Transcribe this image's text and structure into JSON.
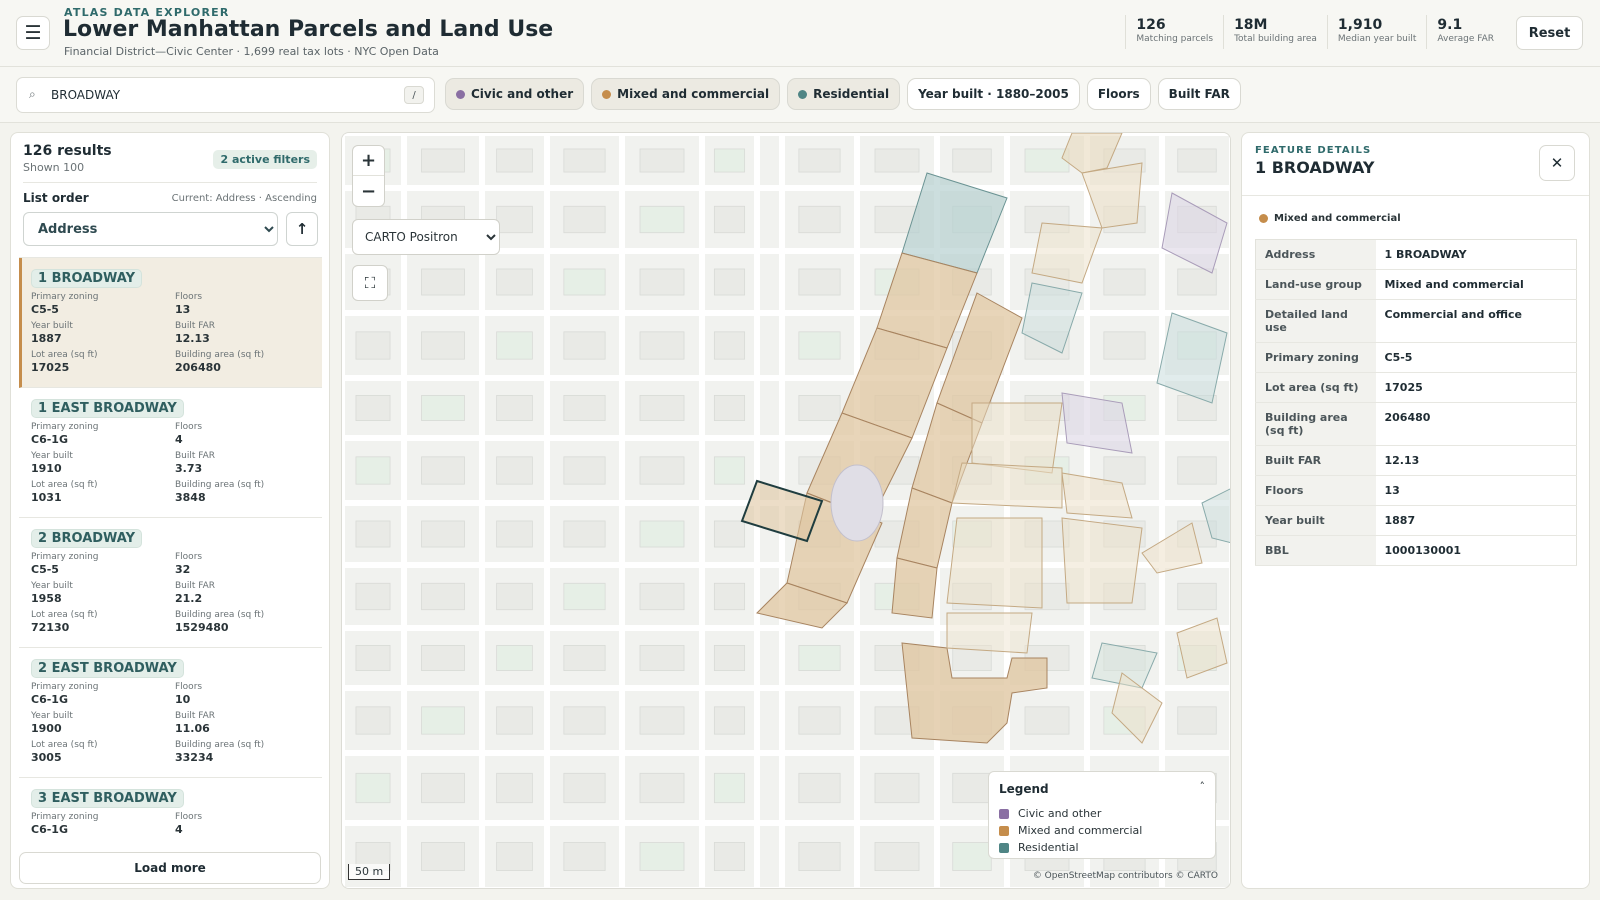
{
  "header": {
    "eyebrow": "ATLAS DATA EXPLORER",
    "title": "Lower Manhattan Parcels and Land Use",
    "subtitle": "Financial District—Civic Center · 1,699 real tax lots · NYC Open Data",
    "stats": [
      {
        "value": "126",
        "label": "Matching parcels"
      },
      {
        "value": "18M",
        "label": "Total building area"
      },
      {
        "value": "1,910",
        "label": "Median year built"
      },
      {
        "value": "9.1",
        "label": "Average FAR"
      }
    ],
    "reset_label": "Reset",
    "menu_icon": "☰"
  },
  "search": {
    "icon": "⌕",
    "value": "BROADWAY",
    "shortcut": "/"
  },
  "chips": [
    {
      "label": "Civic and other",
      "color": "#8a6fa3",
      "active": true
    },
    {
      "label": "Mixed and commercial",
      "color": "#c58d4c",
      "active": true
    },
    {
      "label": "Residential",
      "color": "#4f8585",
      "active": true
    },
    {
      "label": "Year built · 1880–2005"
    },
    {
      "label": "Floors"
    },
    {
      "label": "Built FAR"
    }
  ],
  "results": {
    "count_label": "126 results",
    "shown_label": "Shown 100",
    "filters_badge": "2 active filters",
    "order_label": "List order",
    "order_current": "Current: Address · Ascending",
    "order_value": "Address",
    "order_options": [
      "Address"
    ],
    "direction_icon": "↑",
    "load_more_label": "Load more",
    "field_labels": {
      "zoning": "Primary zoning",
      "floors": "Floors",
      "year": "Year built",
      "far": "Built FAR",
      "lot": "Lot area (sq ft)",
      "bldg": "Building area (sq ft)"
    },
    "items": [
      {
        "title": "1 BROADWAY",
        "zoning": "C5-5",
        "floors": "13",
        "year": "1887",
        "far": "12.13",
        "lot": "17025",
        "bldg": "206480"
      },
      {
        "title": "1 EAST BROADWAY",
        "zoning": "C6-1G",
        "floors": "4",
        "year": "1910",
        "far": "3.73",
        "lot": "1031",
        "bldg": "3848"
      },
      {
        "title": "2 BROADWAY",
        "zoning": "C5-5",
        "floors": "32",
        "year": "1958",
        "far": "21.2",
        "lot": "72130",
        "bldg": "1529480"
      },
      {
        "title": "2 EAST BROADWAY",
        "zoning": "C6-1G",
        "floors": "10",
        "year": "1900",
        "far": "11.06",
        "lot": "3005",
        "bldg": "33234"
      },
      {
        "title": "3 EAST BROADWAY",
        "zoning": "C6-1G",
        "floors": "4"
      }
    ]
  },
  "map": {
    "zoom_in": "+",
    "zoom_out": "−",
    "basemap_value": "CARTO Positron",
    "fullscreen_icon": "⛶",
    "scale_label": "50 m",
    "attribution": "© OpenStreetMap contributors © CARTO",
    "legend": {
      "title": "Legend",
      "toggle_icon": "˄",
      "items": [
        {
          "label": "Civic and other",
          "color": "#8a6fa3"
        },
        {
          "label": "Mixed and commercial",
          "color": "#c58d4c"
        },
        {
          "label": "Residential",
          "color": "#4f8585"
        }
      ]
    }
  },
  "details": {
    "eyebrow": "FEATURE DETAILS",
    "title": "1 BROADWAY",
    "close_icon": "✕",
    "land_use_badge": "Mixed and commercial",
    "land_use_color": "#c58d4c",
    "rows": [
      {
        "key": "Address",
        "value": "1 BROADWAY"
      },
      {
        "key": "Land-use group",
        "value": "Mixed and commercial"
      },
      {
        "key": "Detailed land use",
        "value": "Commercial and office"
      },
      {
        "key": "Primary zoning",
        "value": "C5-5"
      },
      {
        "key": "Lot area (sq ft)",
        "value": "17025"
      },
      {
        "key": "Building area (sq ft)",
        "value": "206480"
      },
      {
        "key": "Built FAR",
        "value": "12.13"
      },
      {
        "key": "Floors",
        "value": "13"
      },
      {
        "key": "Year built",
        "value": "1887"
      },
      {
        "key": "BBL",
        "value": "1000130001"
      }
    ]
  }
}
